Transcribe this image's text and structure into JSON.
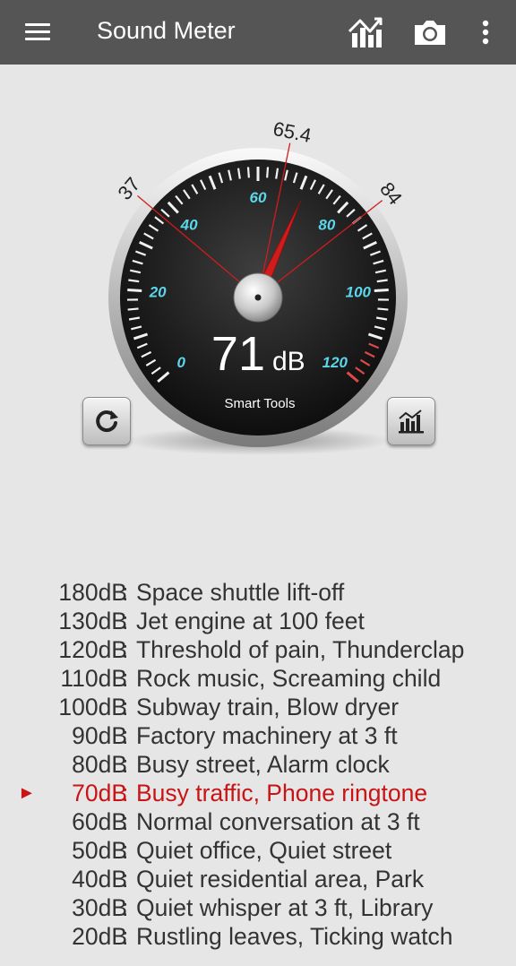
{
  "app_title": "Sound Meter",
  "toolbar": {
    "menu_icon": "hamburger-menu-icon",
    "chart_icon": "trend-chart-icon",
    "camera_icon": "camera-icon",
    "more_icon": "more-vert-icon"
  },
  "gauge": {
    "current_value": "71",
    "unit": "dB",
    "brand": "Smart Tools",
    "needle_value": 71,
    "avg_value": 65.4,
    "min_value": 37,
    "max_value": 84,
    "avg_label": "65.4",
    "min_label": "37",
    "max_label": "84",
    "scale_min": 0,
    "scale_max": 120,
    "ticks": [
      "0",
      "20",
      "40",
      "60",
      "80",
      "100",
      "120"
    ],
    "tick_color": "#5bd6ea",
    "needle_color": "#d21c1c"
  },
  "buttons": {
    "reset_icon": "refresh-icon",
    "stats_icon": "bar-chart-icon"
  },
  "reference": [
    {
      "db": "180dB",
      "desc": "Space shuttle lift-off",
      "active": false
    },
    {
      "db": "130dB",
      "desc": "Jet engine at 100 feet",
      "active": false
    },
    {
      "db": "120dB",
      "desc": "Threshold of pain, Thunderclap",
      "active": false
    },
    {
      "db": "110dB",
      "desc": "Rock music, Screaming child",
      "active": false
    },
    {
      "db": "100dB",
      "desc": "Subway train, Blow dryer",
      "active": false
    },
    {
      "db": "90dB",
      "desc": "Factory machinery at 3 ft",
      "active": false
    },
    {
      "db": "80dB",
      "desc": "Busy street, Alarm clock",
      "active": false
    },
    {
      "db": "70dB",
      "desc": "Busy traffic, Phone ringtone",
      "active": true
    },
    {
      "db": "60dB",
      "desc": "Normal conversation at 3 ft",
      "active": false
    },
    {
      "db": "50dB",
      "desc": "Quiet office, Quiet street",
      "active": false
    },
    {
      "db": "40dB",
      "desc": "Quiet residential area, Park",
      "active": false
    },
    {
      "db": "30dB",
      "desc": "Quiet whisper at 3 ft, Library",
      "active": false
    },
    {
      "db": "20dB",
      "desc": "Rustling leaves, Ticking watch",
      "active": false
    }
  ],
  "separator": ":",
  "active_marker": "►",
  "accent_color": "#c81414"
}
